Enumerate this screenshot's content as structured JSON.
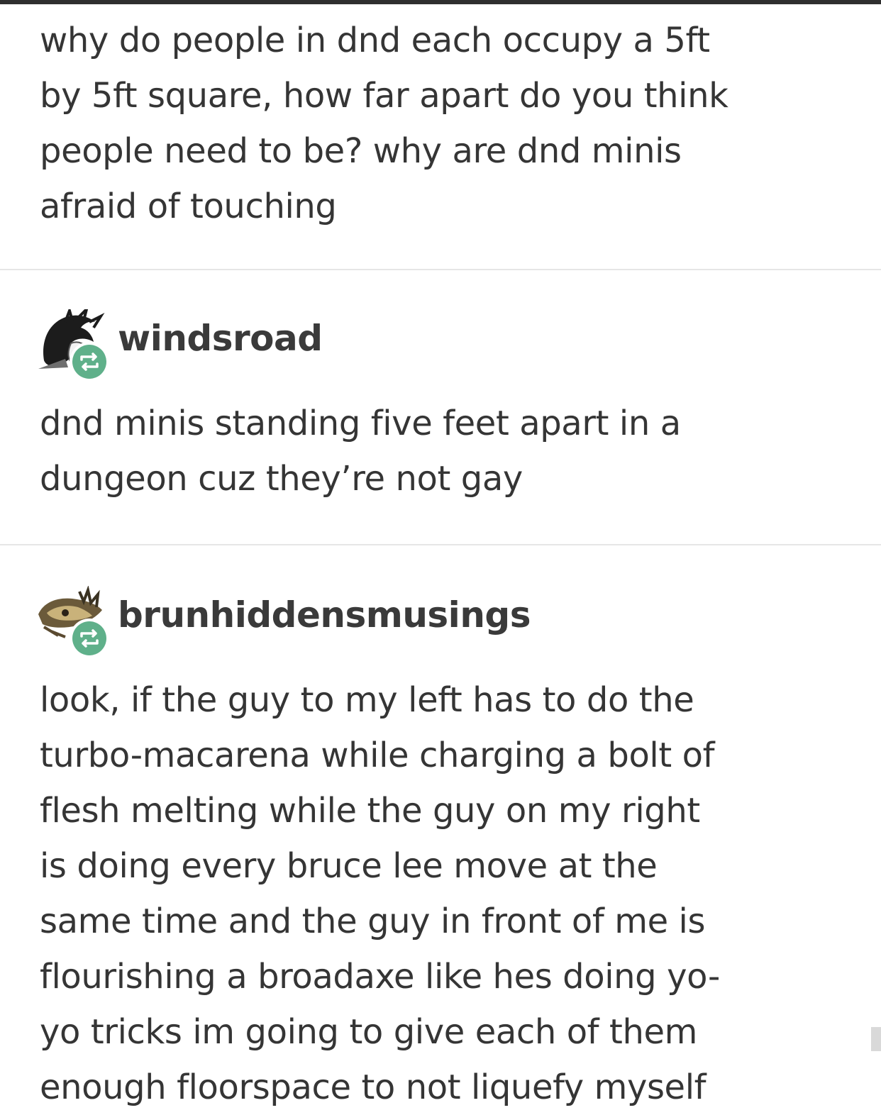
{
  "original_post": {
    "text": "why do people in dnd each occupy a 5ft\nby 5ft square, how far apart do you think\npeople need to be? why are dnd minis\nafraid of touching"
  },
  "reblogs": [
    {
      "username": "windsroad",
      "text": "dnd minis standing five feet apart in a\ndungeon cuz they’re not gay",
      "avatar_icon": "windsroad-avatar-icon",
      "badge_icon": "reblog-icon"
    },
    {
      "username": "brunhiddensmusings",
      "text": "look, if the guy to my left has to do the\nturbo-macarena while charging a bolt of\nflesh melting while the guy on my right\nis doing every bruce lee move at the\nsame time and the guy in front of me is\nflourishing a broadaxe like hes doing yo-\nyo tricks im going to give each of them\nenough floorspace to not liquefy myself",
      "avatar_icon": "brunhiddensmusings-avatar-icon",
      "badge_icon": "reblog-icon"
    }
  ],
  "colors": {
    "text": "#353535",
    "username": "#3a3a3a",
    "reblog_badge": "#5fb08a",
    "divider": "#e6e6e6"
  }
}
